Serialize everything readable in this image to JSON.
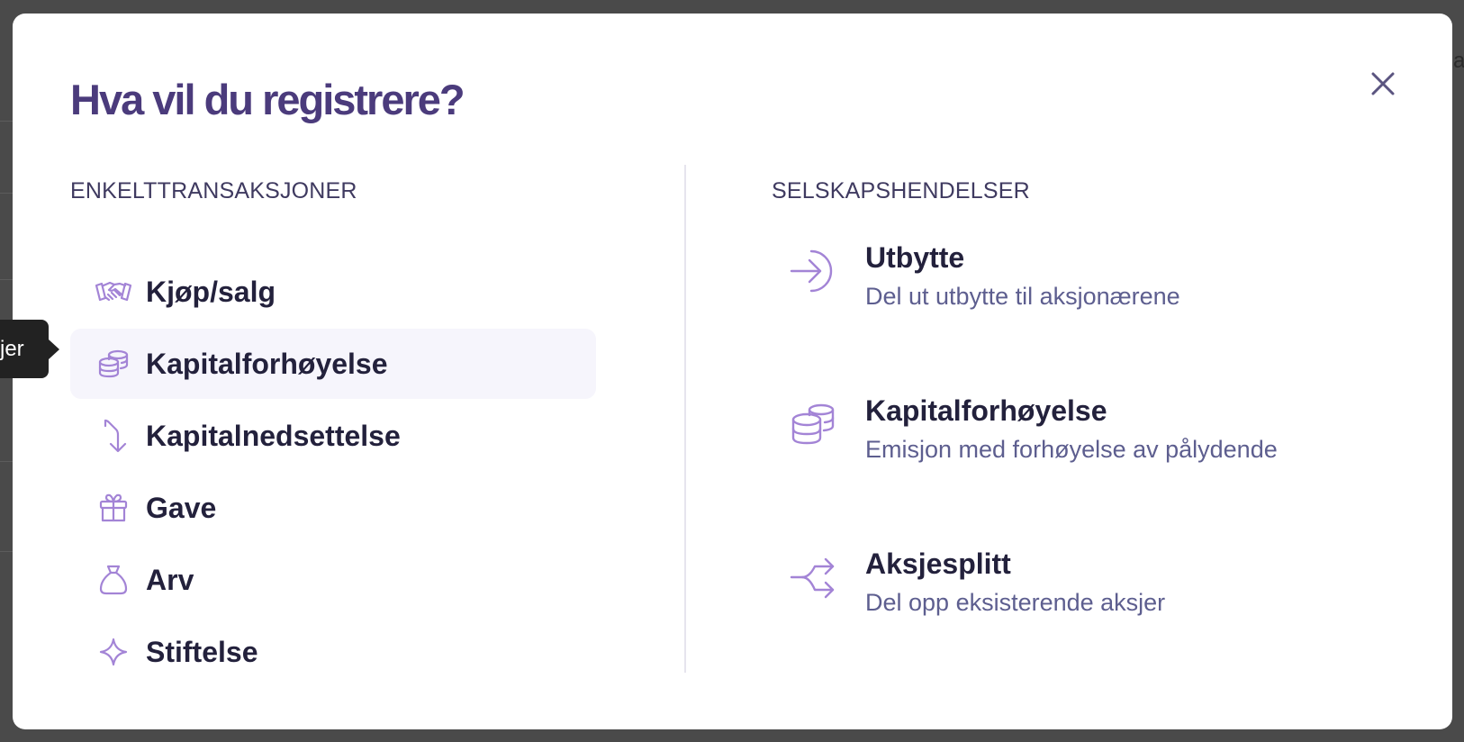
{
  "background": {
    "visible_letter": "a"
  },
  "tooltip": {
    "text": "jer"
  },
  "modal": {
    "title": "Hva vil du registrere?",
    "close_icon": "close-icon",
    "left_section": {
      "heading": "ENKELTTRANSAKSJONER",
      "items": [
        {
          "label": "Kjøp/salg",
          "icon": "handshake-icon"
        },
        {
          "label": "Kapitalforhøyelse",
          "icon": "coins-icon",
          "hovered": true
        },
        {
          "label": "Kapitalnedsettelse",
          "icon": "arrow-turn-down-icon"
        },
        {
          "label": "Gave",
          "icon": "gift-icon"
        },
        {
          "label": "Arv",
          "icon": "money-bag-icon"
        },
        {
          "label": "Stiftelse",
          "icon": "sparkle-icon"
        }
      ]
    },
    "right_section": {
      "heading": "SELSKAPSHENDELSER",
      "events": [
        {
          "title": "Utbytte",
          "description": "Del ut utbytte til aksjonærene",
          "icon": "arrow-right-to-arc-icon"
        },
        {
          "title": "Kapitalforhøyelse",
          "description": "Emisjon med forhøyelse av pålydende",
          "icon": "coins-stack-icon"
        },
        {
          "title": "Aksjesplitt",
          "description": "Del opp eksisterende aksjer",
          "icon": "split-arrows-icon"
        }
      ]
    }
  },
  "colors": {
    "title": "#4b3b7c",
    "icon": "#a384d6",
    "hover_bg": "#f6f5fc",
    "label": "#23213c",
    "description": "#5d5e8f"
  }
}
